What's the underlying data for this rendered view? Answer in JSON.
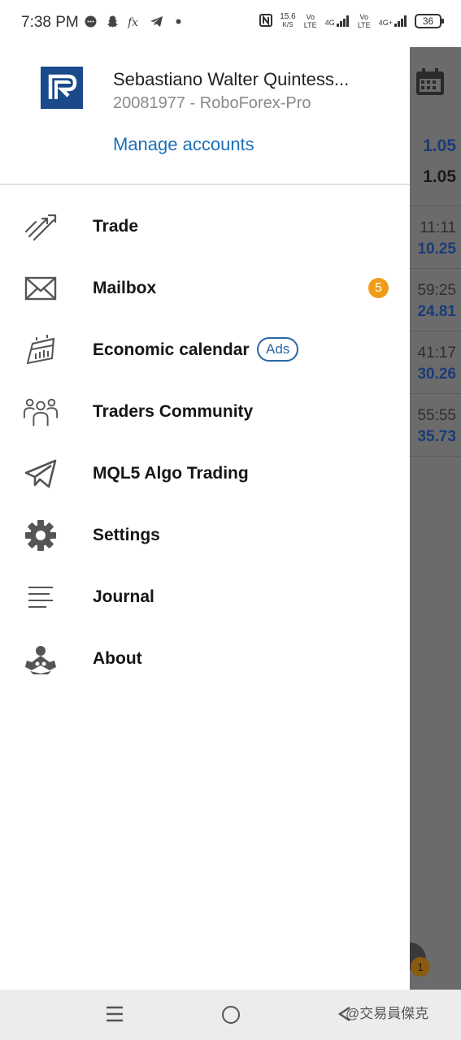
{
  "status_bar": {
    "time": "7:38 PM",
    "net_speed": "15.6",
    "net_unit": "K/S",
    "sim1_label": "Vo LTE",
    "sim1_gen": "4G",
    "sim2_label": "Vo LTE",
    "sim2_gen": "4G+",
    "battery": "36"
  },
  "drawer": {
    "account_name": "Sebastiano Walter Quintess...",
    "account_sub": "20081977 - RoboForex-Pro",
    "manage_accounts": "Manage accounts",
    "menu": [
      {
        "label": "Trade",
        "icon": "trade-icon"
      },
      {
        "label": "Mailbox",
        "icon": "mail-icon",
        "badge": "5"
      },
      {
        "label": "Economic calendar",
        "icon": "calendar-icon",
        "tag": "Ads"
      },
      {
        "label": "Traders Community",
        "icon": "community-icon"
      },
      {
        "label": "MQL5 Algo Trading",
        "icon": "telegram-icon"
      },
      {
        "label": "Settings",
        "icon": "gear-icon"
      },
      {
        "label": "Journal",
        "icon": "journal-icon"
      },
      {
        "label": "About",
        "icon": "about-icon"
      }
    ]
  },
  "background": {
    "quotes": [
      {
        "text": "1.05",
        "style": "blue"
      },
      {
        "text": "1.05",
        "style": "dark"
      },
      {
        "text": "11:11",
        "style": "grey"
      },
      {
        "text": "10.25",
        "style": "blue"
      },
      {
        "text": "59:25",
        "style": "grey"
      },
      {
        "text": "24.81",
        "style": "blue"
      },
      {
        "text": "41:17",
        "style": "grey"
      },
      {
        "text": "30.26",
        "style": "blue"
      },
      {
        "text": "55:55",
        "style": "grey"
      },
      {
        "text": "35.73",
        "style": "blue"
      }
    ],
    "fab_badge": "1"
  },
  "watermark": "@交易員傑克",
  "colors": {
    "accent_blue": "#1d6fb5",
    "badge_orange": "#f29b16",
    "logo_blue": "#1b4a8a"
  }
}
